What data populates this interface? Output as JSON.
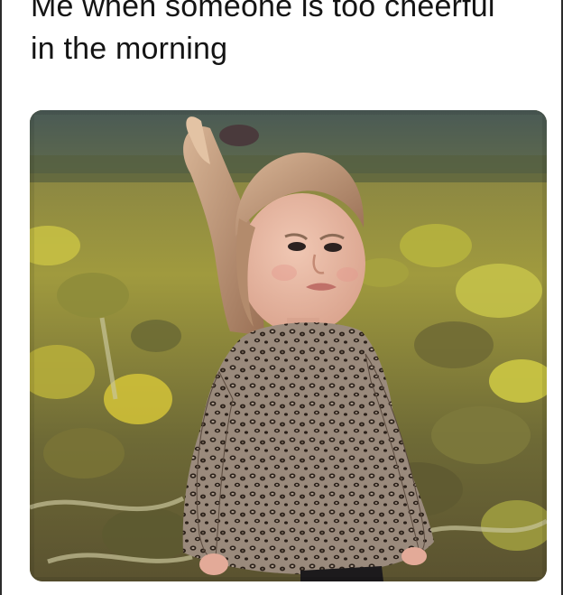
{
  "meme": {
    "caption_line_1": "Me when someone is too cheerful",
    "caption_line_2": "in the morning"
  },
  "photo": {
    "subject": "toddler-girl-frowning-in-pumpkin-field"
  },
  "colors": {
    "background": "#ffffff",
    "text": "#141414",
    "field_green": "#8f8a3a",
    "leopard_base": "#8a7b6e"
  }
}
